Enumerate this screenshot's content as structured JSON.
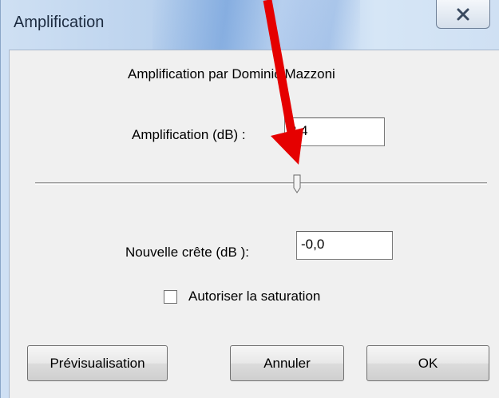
{
  "window": {
    "title": "Amplification"
  },
  "dialog": {
    "effect_title": "Amplification par Dominic Mazzoni",
    "amplification": {
      "label": "Amplification (dB) :",
      "value": "3,4"
    },
    "slider": {
      "position_fraction": 0.58
    },
    "peak": {
      "label": "Nouvelle crête (dB ):",
      "value": "-0,0"
    },
    "allow_clipping": {
      "label": "Autoriser la saturation",
      "checked": false
    },
    "buttons": {
      "preview": "Prévisualisation",
      "cancel": "Annuler",
      "ok": "OK"
    }
  },
  "colors": {
    "annotation_arrow": "#e50000",
    "titlebar": "#bcd3ee",
    "dialog_bg": "#f0f0f0"
  },
  "icons": {
    "close": "close-x-icon",
    "annotation": "red-arrow-annotation"
  }
}
